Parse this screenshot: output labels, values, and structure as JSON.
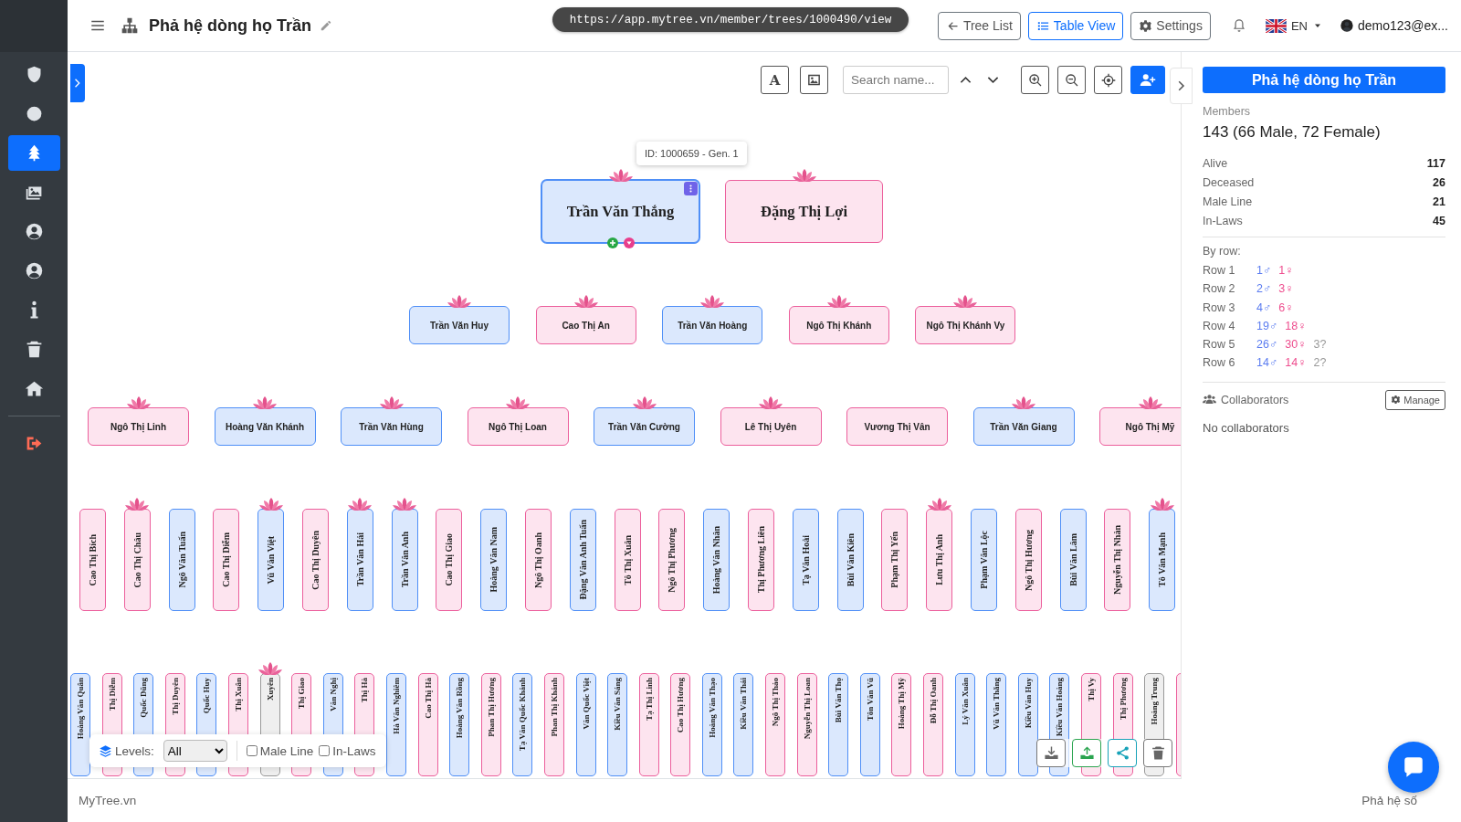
{
  "sidebar": {
    "items": [
      {
        "kind": "shield",
        "selected": false
      },
      {
        "kind": "circle",
        "selected": false
      },
      {
        "kind": "tree",
        "selected": true
      },
      {
        "kind": "images",
        "selected": false
      },
      {
        "kind": "user",
        "selected": false
      },
      {
        "kind": "user",
        "selected": false
      },
      {
        "kind": "info",
        "selected": false
      },
      {
        "kind": "trash",
        "selected": false
      },
      {
        "kind": "home",
        "selected": false
      },
      {
        "kind": "logout",
        "selected": false
      }
    ]
  },
  "header": {
    "title": "Phả hệ dòng họ Trần",
    "url": "https://app.mytree.vn/member/trees/1000490/view",
    "buttons": [
      {
        "label": "Tree List",
        "kind": "back",
        "selected": false
      },
      {
        "label": "Table View",
        "kind": "list",
        "selected": true
      },
      {
        "label": "Settings",
        "kind": "gear",
        "selected": false
      }
    ],
    "language": "EN",
    "user": "demo123@ex..."
  },
  "toolbar": {
    "font_button": "A",
    "search": {
      "placeholder": "Search name..."
    }
  },
  "tooltip": "ID: 1000659 - Gen. 1",
  "tree": {
    "rows": [
      {
        "members": [
          {
            "name": "Trần Văn Thắng",
            "kind": "male",
            "flower": true,
            "selected": true
          },
          {
            "name": "Đặng Thị Lợi",
            "kind": "female",
            "flower": true,
            "selected": false
          }
        ]
      },
      {
        "members": [
          {
            "name": "Trần Văn Huy",
            "kind": "male",
            "flower": true,
            "selected": false
          },
          {
            "name": "Cao Thị An",
            "kind": "female",
            "flower": true,
            "selected": false
          },
          {
            "name": "Trần Văn Hoàng",
            "kind": "male",
            "flower": true,
            "selected": false
          },
          {
            "name": "Ngô Thị Khánh",
            "kind": "female",
            "flower": true,
            "selected": false
          },
          {
            "name": "Ngô Thị Khánh Vy",
            "kind": "female",
            "flower": true,
            "selected": false
          }
        ]
      },
      {
        "members": [
          {
            "name": "Ngô Thị Linh",
            "kind": "female",
            "flower": true,
            "selected": false
          },
          {
            "name": "Hoàng Văn Khánh",
            "kind": "male",
            "flower": true,
            "selected": false
          },
          {
            "name": "Trần Văn Hùng",
            "kind": "male",
            "flower": true,
            "selected": false
          },
          {
            "name": "Ngô Thị Loan",
            "kind": "female",
            "flower": true,
            "selected": false
          },
          {
            "name": "Trần Văn Cường",
            "kind": "male",
            "flower": true,
            "selected": false
          },
          {
            "name": "Lê Thị Uyên",
            "kind": "female",
            "flower": true,
            "selected": false
          },
          {
            "name": "Vương Thị Vân",
            "kind": "female",
            "flower": false,
            "selected": false
          },
          {
            "name": "Trần Văn Giang",
            "kind": "male",
            "flower": true,
            "selected": false
          },
          {
            "name": "Ngô Thị Mỹ",
            "kind": "female",
            "flower": true,
            "selected": false
          }
        ]
      },
      {
        "members": [
          {
            "name": "Cao Thị Bích",
            "kind": "female",
            "flower": false,
            "selected": false
          },
          {
            "name": "Cao Thị Châu",
            "kind": "female",
            "flower": true,
            "selected": false
          },
          {
            "name": "Ngô Văn Tuấn",
            "kind": "male",
            "flower": false,
            "selected": false
          },
          {
            "name": "Cao Thị Diễm",
            "kind": "female",
            "flower": false,
            "selected": false
          },
          {
            "name": "Vũ Văn Việt",
            "kind": "male",
            "flower": true,
            "selected": false
          },
          {
            "name": "Cao Thị Duyên",
            "kind": "female",
            "flower": false,
            "selected": false
          },
          {
            "name": "Trần Văn Hải",
            "kind": "male",
            "flower": true,
            "selected": false
          },
          {
            "name": "Trần Văn Anh",
            "kind": "male",
            "flower": true,
            "selected": false
          },
          {
            "name": "Cao Thị Giao",
            "kind": "female",
            "flower": false,
            "selected": false
          },
          {
            "name": "Hoàng Văn Nam",
            "kind": "male",
            "flower": false,
            "selected": false
          },
          {
            "name": "Ngô Thị Oanh",
            "kind": "female",
            "flower": false,
            "selected": false
          },
          {
            "name": "Đặng Văn Anh Tuấn",
            "kind": "male",
            "flower": false,
            "selected": false
          },
          {
            "name": "Tô Thị Xuân",
            "kind": "female",
            "flower": false,
            "selected": false
          },
          {
            "name": "Ngô Thị Phương",
            "kind": "female",
            "flower": false,
            "selected": false
          },
          {
            "name": "Hoàng Văn Nhân",
            "kind": "male",
            "flower": false,
            "selected": false
          },
          {
            "name": "Thị Phương Liên",
            "kind": "female",
            "flower": false,
            "selected": false
          },
          {
            "name": "Tạ Văn Hoài",
            "kind": "male",
            "flower": false,
            "selected": false
          },
          {
            "name": "Bùi Văn Kiên",
            "kind": "male",
            "flower": false,
            "selected": false
          },
          {
            "name": "Phạm Thị Yến",
            "kind": "female",
            "flower": false,
            "selected": false
          },
          {
            "name": "Lưu Thị Anh",
            "kind": "female",
            "flower": true,
            "selected": false
          },
          {
            "name": "Phạm Văn Lộc",
            "kind": "male",
            "flower": false,
            "selected": false
          },
          {
            "name": "Ngô Thị Hương",
            "kind": "female",
            "flower": false,
            "selected": false
          },
          {
            "name": "Bùi Văn Lâm",
            "kind": "male",
            "flower": false,
            "selected": false
          },
          {
            "name": "Nguyễn Thị Nhàn",
            "kind": "female",
            "flower": false,
            "selected": false
          },
          {
            "name": "Tô Văn Mạnh",
            "kind": "male",
            "flower": true,
            "selected": false
          }
        ]
      },
      {
        "members": [
          {
            "name": "Hoàng Văn Quân",
            "kind": "male",
            "flower": false,
            "selected": false
          },
          {
            "name": "Thị Diễm",
            "kind": "female",
            "flower": false,
            "selected": false
          },
          {
            "name": "Quốc Dũng",
            "kind": "male",
            "flower": false,
            "selected": false
          },
          {
            "name": "Thị Duyên",
            "kind": "female",
            "flower": false,
            "selected": false
          },
          {
            "name": "Quốc Huy",
            "kind": "male",
            "flower": false,
            "selected": false
          },
          {
            "name": "Thị Xuân",
            "kind": "female",
            "flower": false,
            "selected": false
          },
          {
            "name": "Xuyên",
            "kind": "unknown",
            "flower": true,
            "selected": false
          },
          {
            "name": "Thị Giao",
            "kind": "female",
            "flower": false,
            "selected": false
          },
          {
            "name": "Văn Nghị",
            "kind": "male",
            "flower": false,
            "selected": false
          },
          {
            "name": "Thị Hà",
            "kind": "female",
            "flower": false,
            "selected": false
          },
          {
            "name": "Hà Văn Nghiêm",
            "kind": "male",
            "flower": false,
            "selected": false
          },
          {
            "name": "Cao Thị Hà",
            "kind": "female",
            "flower": false,
            "selected": false
          },
          {
            "name": "Hoàng Văn Rồng",
            "kind": "male",
            "flower": false,
            "selected": false
          },
          {
            "name": "Phan Thị Hương",
            "kind": "female",
            "flower": false,
            "selected": false
          },
          {
            "name": "Tạ Văn Quốc Khánh",
            "kind": "male",
            "flower": false,
            "selected": false
          },
          {
            "name": "Phan Thị Khánh",
            "kind": "female",
            "flower": false,
            "selected": false
          },
          {
            "name": "Văn Quốc Việt",
            "kind": "male",
            "flower": false,
            "selected": false
          },
          {
            "name": "Kiều Văn Sáng",
            "kind": "male",
            "flower": false,
            "selected": false
          },
          {
            "name": "Tạ Thị Linh",
            "kind": "female",
            "flower": false,
            "selected": false
          },
          {
            "name": "Cao Thị Hương",
            "kind": "female",
            "flower": false,
            "selected": false
          },
          {
            "name": "Hoàng Văn Thạo",
            "kind": "male",
            "flower": false,
            "selected": false
          },
          {
            "name": "Kiều Văn Thái",
            "kind": "male",
            "flower": false,
            "selected": false
          },
          {
            "name": "Ngô Thị Thảo",
            "kind": "female",
            "flower": false,
            "selected": false
          },
          {
            "name": "Nguyễn Thị Loan",
            "kind": "female",
            "flower": false,
            "selected": false
          },
          {
            "name": "Bùi Văn Thọ",
            "kind": "male",
            "flower": false,
            "selected": false
          },
          {
            "name": "Tôn Văn Vũ",
            "kind": "male",
            "flower": false,
            "selected": false
          },
          {
            "name": "Hoàng Thị Mỹ",
            "kind": "female",
            "flower": false,
            "selected": false
          },
          {
            "name": "Đỗ Thị Oanh",
            "kind": "female",
            "flower": false,
            "selected": false
          },
          {
            "name": "Lý Văn Xuân",
            "kind": "male",
            "flower": false,
            "selected": false
          },
          {
            "name": "Vũ Văn Thắng",
            "kind": "male",
            "flower": false,
            "selected": false
          },
          {
            "name": "Kiều Văn Huy",
            "kind": "male",
            "flower": false,
            "selected": false
          },
          {
            "name": "Kiều Văn Hoàng",
            "kind": "male",
            "flower": false,
            "selected": false
          },
          {
            "name": "Thị Vy",
            "kind": "female",
            "flower": false,
            "selected": false
          },
          {
            "name": "Thị Phương",
            "kind": "female",
            "flower": false,
            "selected": false
          },
          {
            "name": "Hoàng Trung",
            "kind": "unknown",
            "flower": false,
            "selected": false
          },
          {
            "kind": "female",
            "flower": false,
            "selected": false
          }
        ]
      }
    ]
  },
  "filters": {
    "levels_label": "Levels:",
    "levels_value": "All",
    "checkboxes": [
      {
        "label": "Male Line",
        "checked": false
      },
      {
        "label": "In-Laws",
        "checked": false
      }
    ]
  },
  "panel": {
    "title": "Phả hệ dòng họ Trần",
    "members_label": "Members",
    "members": "143 (66 Male, 72 Female)",
    "stats": [
      {
        "label": "Alive",
        "value": "117"
      },
      {
        "label": "Deceased",
        "value": "26"
      },
      {
        "label": "Male Line",
        "value": "21"
      },
      {
        "label": "In-Laws",
        "value": "45"
      }
    ],
    "by_row_label": "By row:",
    "by_row": [
      {
        "label": "Row 1",
        "male": "1♂",
        "female": "1♀"
      },
      {
        "label": "Row 2",
        "male": "2♂",
        "female": "3♀"
      },
      {
        "label": "Row 3",
        "male": "4♂",
        "female": "6♀"
      },
      {
        "label": "Row 4",
        "male": "19♂",
        "female": "18♀"
      },
      {
        "label": "Row 5",
        "male": "26♂",
        "female": "30♀",
        "unknown": "3?"
      },
      {
        "label": "Row 6",
        "male": "14♂",
        "female": "14♀",
        "unknown": "2?"
      }
    ],
    "collaborators_label": "Collaborators",
    "manage": "Manage",
    "collaborators_empty": "No collaborators"
  },
  "footer": {
    "left": "MyTree.vn",
    "right": "Phả hệ số"
  }
}
